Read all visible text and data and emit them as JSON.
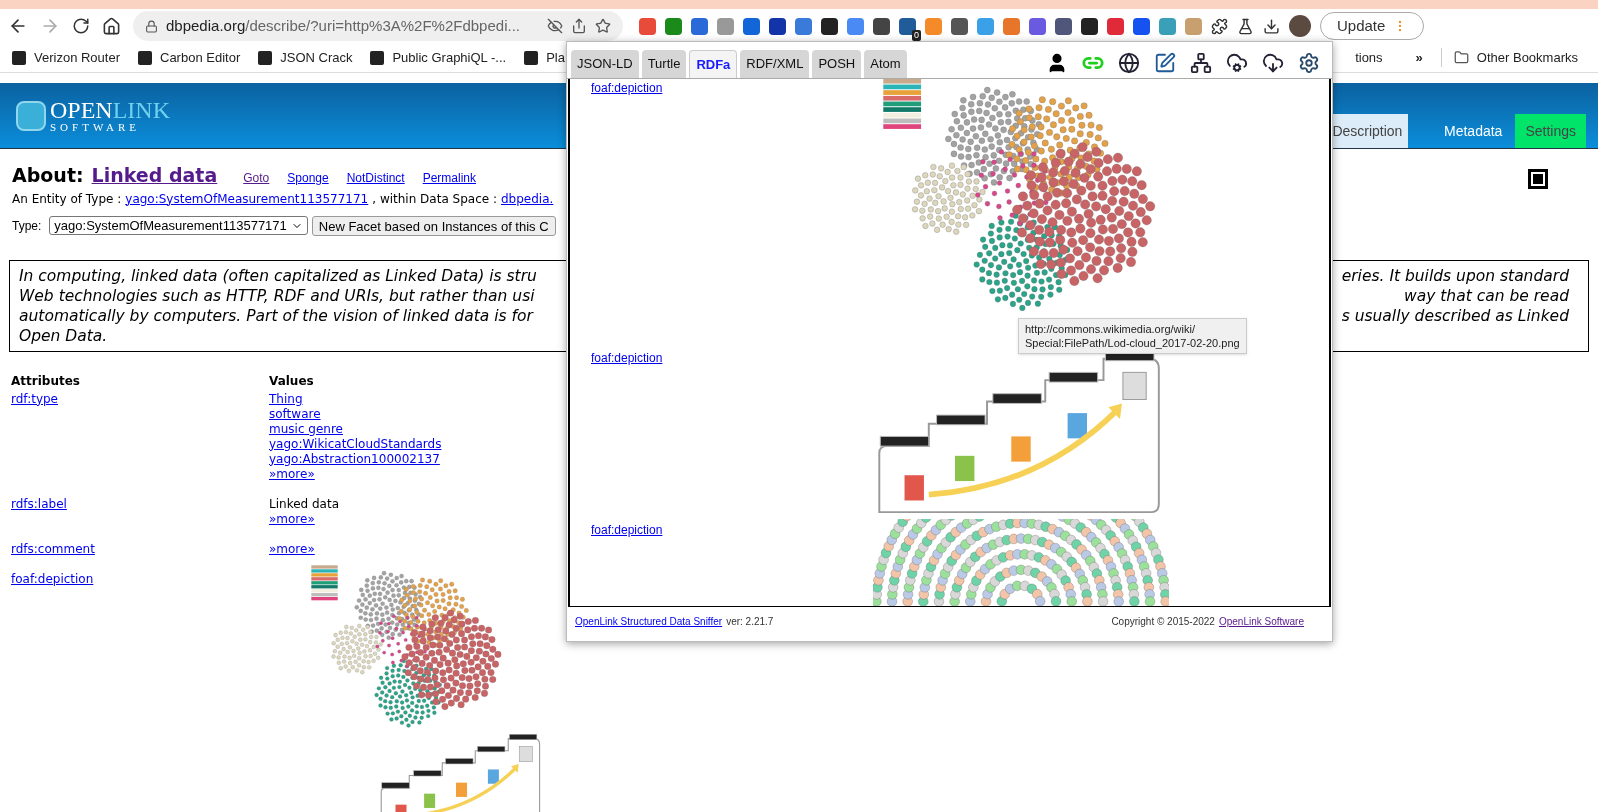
{
  "browser": {
    "address": {
      "host": "dbpedia.org",
      "path": "/describe/?uri=http%3A%2F%2Fdbpedi..."
    },
    "extension_badge": "0",
    "update_button": "Update",
    "bookmarks": [
      {
        "label": "Verizon Router"
      },
      {
        "label": "Carbon Editor"
      },
      {
        "label": "JSON Crack"
      },
      {
        "label": "Public GraphiQL -..."
      },
      {
        "label": "Pla"
      }
    ],
    "bookmarks_right": {
      "partial": "tions",
      "overflow": "»",
      "other": "Other Bookmarks"
    }
  },
  "site": {
    "logo": {
      "main": "OPEN",
      "accent": "LINK",
      "sub": "SOFTWARE"
    },
    "nav": [
      {
        "label": "Description",
        "selected": true,
        "kind": "tab"
      },
      {
        "label": "Metadata",
        "selected": false,
        "kind": "tab"
      },
      {
        "label": "Settings",
        "selected": false,
        "kind": "action"
      }
    ]
  },
  "about": {
    "label": "About:",
    "title": "Linked data",
    "links": [
      {
        "text": "Goto",
        "visited": true
      },
      {
        "text": "Sponge",
        "visited": false
      },
      {
        "text": "NotDistinct",
        "visited": false
      },
      {
        "text": "Permalink",
        "visited": false
      }
    ],
    "entity_prefix": "An Entity of Type :",
    "entity_type": "yago:SystemOfMeasurement113577171",
    "space_prefix": ", within Data Space :",
    "space": "dbpedia.",
    "type_label": "Type:",
    "type_value": "yago:SystemOfMeasurement113577171",
    "facet_button": "New Facet based on Instances of this C"
  },
  "abstract": {
    "left_lines": [
      "In computing, linked data (often capitalized as Linked Data) is stru",
      "Web technologies such as HTTP, RDF and URIs, but rather than usi",
      "automatically by computers. Part of the vision of linked data is for",
      "Open Data."
    ],
    "right_lines": [
      "eries. It builds upon standard",
      "way that can be read",
      "s usually described as Linked"
    ]
  },
  "properties": {
    "columns": [
      "Attributes",
      "Values"
    ],
    "rows": [
      {
        "attribute": "rdf:type",
        "values": [
          {
            "kind": "link",
            "text": "Thing"
          },
          {
            "kind": "link",
            "text": "software"
          },
          {
            "kind": "link",
            "text": "music genre"
          },
          {
            "kind": "link",
            "text": "yago:WikicatCloudStandards"
          },
          {
            "kind": "link",
            "text": "yago:Abstraction100002137"
          },
          {
            "kind": "link",
            "text": "»more»"
          }
        ]
      },
      {
        "attribute": "rdfs:label",
        "values": [
          {
            "kind": "plain",
            "text": "Linked data"
          },
          {
            "kind": "link",
            "text": "»more»"
          }
        ]
      },
      {
        "attribute": "rdfs:comment",
        "values": [
          {
            "kind": "link",
            "text": "»more»"
          }
        ]
      },
      {
        "attribute": "foaf:depiction",
        "values": [
          {
            "kind": "cloud"
          },
          {
            "kind": "stars"
          }
        ]
      }
    ]
  },
  "sniffer": {
    "tabs": [
      {
        "label": "JSON-LD",
        "selected": false
      },
      {
        "label": "Turtle",
        "selected": false
      },
      {
        "label": "RDFa",
        "selected": true
      },
      {
        "label": "RDF/XML",
        "selected": false
      },
      {
        "label": "POSH",
        "selected": false
      },
      {
        "label": "Atom",
        "selected": false
      }
    ],
    "items": [
      {
        "property": "foaf:depiction",
        "kind": "cloud"
      },
      {
        "property": "foaf:depiction",
        "kind": "stars"
      },
      {
        "property": "foaf:depiction",
        "kind": "wheel"
      }
    ],
    "tooltip": [
      "http://commons.wikimedia.org/wiki/",
      "Special:FilePath/Lod-cloud_2017-02-20.png"
    ],
    "footer": {
      "app_link": "OpenLink Structured Data Sniffer",
      "version": "ver: 2.21.7",
      "copyright": "Copyright © 2015-2022",
      "company_link": "OpenLink Software"
    }
  }
}
